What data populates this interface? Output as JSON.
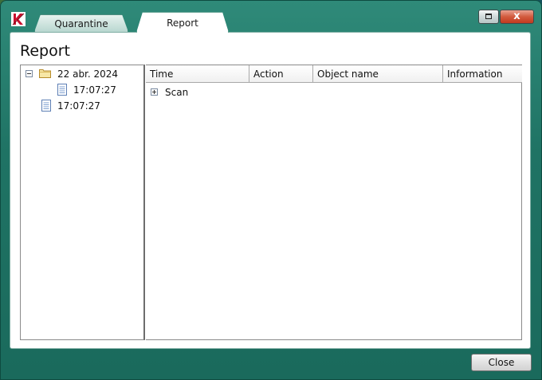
{
  "tabs": [
    {
      "label": "Quarantine"
    },
    {
      "label": "Report"
    }
  ],
  "title_bar": {
    "close_glyph": "x"
  },
  "page": {
    "title": "Report"
  },
  "tree": {
    "items": [
      {
        "label": "22 abr. 2024",
        "icon": "folder-icon",
        "expanded": true
      },
      {
        "label": "17:07:27",
        "icon": "document-icon"
      },
      {
        "label": "17:07:27",
        "icon": "document-icon"
      }
    ]
  },
  "table": {
    "columns": [
      "Time",
      "Action",
      "Object name",
      "Information"
    ],
    "rows": [
      {
        "label": "Scan",
        "collapsed": true
      }
    ]
  },
  "footer": {
    "close_label": "Close"
  },
  "colors": {
    "window_frame": "#1f7364",
    "close_button": "#c23a1f"
  }
}
